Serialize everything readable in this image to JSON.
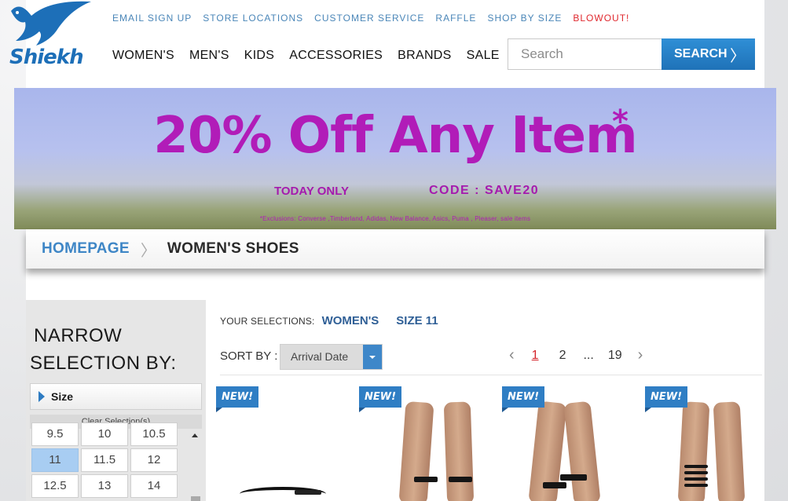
{
  "brand": {
    "logo_text": "Shiekh"
  },
  "utility_nav": [
    "EMAIL SIGN UP",
    "STORE LOCATIONS",
    "CUSTOMER SERVICE",
    "RAFFLE",
    "SHOP BY SIZE",
    "BLOWOUT!"
  ],
  "main_nav": [
    "WOMEN'S",
    "MEN'S",
    "KIDS",
    "ACCESSORIES",
    "BRANDS",
    "SALE"
  ],
  "search": {
    "placeholder": "Search",
    "button_label": "SEARCH"
  },
  "banner": {
    "headline": "20% Off Any Item",
    "asterisk": "*",
    "today_only": "TODAY ONLY",
    "code": "CODE : SAVE20",
    "fine_print": "*Exclusions: Converse ,Timberland, Adidas, New Balance, Asics, Puma , Pleaser, sale items"
  },
  "breadcrumb": {
    "home": "HOMEPAGE",
    "current": "WOMEN'S SHOES"
  },
  "sidebar": {
    "title_line1": "NARROW",
    "title_line2": "SELECTION BY:",
    "size_header": "Size",
    "clear_label": "Clear Selection(s)",
    "sizes": [
      "9.5",
      "10",
      "10.5",
      "11",
      "11.5",
      "12",
      "12.5",
      "13",
      "14"
    ],
    "selected_size": "11"
  },
  "selections": {
    "label": "YOUR SELECTIONS:",
    "tags": [
      "WOMEN'S",
      "SIZE 11"
    ]
  },
  "sort": {
    "label": "SORT BY :",
    "value": "Arrival Date"
  },
  "pagination": {
    "pages": [
      "1",
      "2",
      "...",
      "19"
    ],
    "current": "1"
  },
  "products": [
    {
      "badge": "NEW!"
    },
    {
      "badge": "NEW!"
    },
    {
      "badge": "NEW!"
    },
    {
      "badge": "NEW!"
    }
  ],
  "colors": {
    "accent": "#2f7ec4",
    "promo": "#b11cb8",
    "blowout": "#e0282e"
  }
}
